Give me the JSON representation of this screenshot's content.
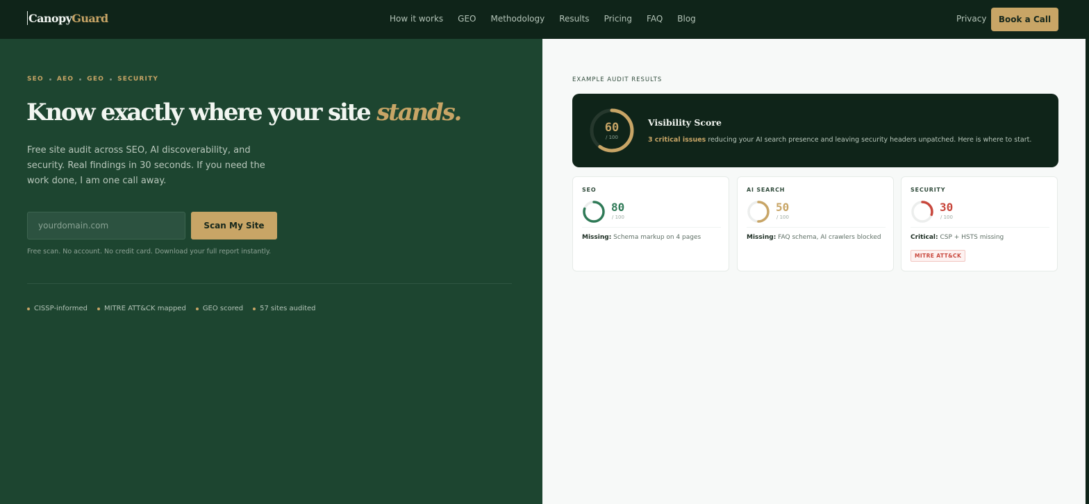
{
  "brand": {
    "part1": "Canopy",
    "part2": "Guard"
  },
  "nav": {
    "links": [
      "How it works",
      "GEO",
      "Methodology",
      "Results",
      "Pricing",
      "FAQ",
      "Blog"
    ],
    "privacy": "Privacy",
    "cta": "Book a Call"
  },
  "hero": {
    "eyebrow": [
      "SEO",
      "AEO",
      "GEO",
      "SECURITY"
    ],
    "headline_main": "Know exactly where your site ",
    "headline_accent": "stands.",
    "subtitle": "Free site audit across SEO, AI discoverability, and security. Real findings in 30 seconds. If you need the work done, I am one call away.",
    "input_placeholder": "yourdomain.com",
    "scan_button": "Scan My Site",
    "note": "Free scan. No account. No credit card. Download your full report instantly.",
    "badges": [
      "CISSP-informed",
      "MITRE ATT&CK mapped",
      "GEO scored",
      "57 sites audited"
    ]
  },
  "audit": {
    "label": "EXAMPLE AUDIT RESULTS",
    "visibility": {
      "title": "Visibility Score",
      "score": "60",
      "score_value": 60,
      "out_of": "/ 100",
      "highlight": "3 critical issues",
      "description": " reducing your AI search presence and leaving security headers unpatched. Here is where to start."
    },
    "cards": [
      {
        "label": "SEO",
        "score": "80",
        "score_value": 80,
        "out_of": "/ 100",
        "desc_label": "Missing:",
        "desc": " Schema markup on 4 pages",
        "color": "#2f7a57",
        "tag": ""
      },
      {
        "label": "AI SEARCH",
        "score": "50",
        "score_value": 50,
        "out_of": "/ 100",
        "desc_label": "Missing:",
        "desc": " FAQ schema, AI crawlers blocked",
        "color": "#c8a566",
        "tag": ""
      },
      {
        "label": "SECURITY",
        "score": "30",
        "score_value": 30,
        "out_of": "/ 100",
        "desc_label": "Critical:",
        "desc": " CSP + HSTS missing",
        "color": "#c8473c",
        "tag": "MITRE ATT&CK"
      }
    ]
  },
  "colors": {
    "gold": "#c8a566",
    "nav_bg": "#0f2419",
    "hero_bg": "#1d4530",
    "seo": "#2f7a57",
    "ai": "#c8a566",
    "security": "#c8473c"
  }
}
